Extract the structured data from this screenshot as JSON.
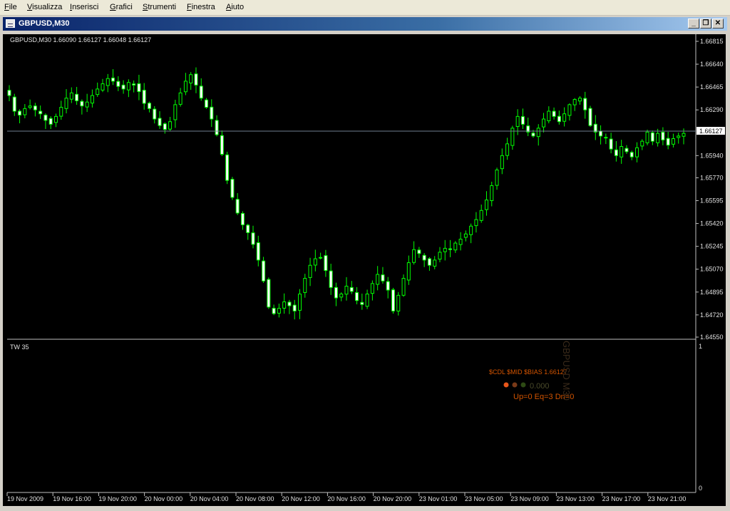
{
  "menu": [
    {
      "label": "File",
      "accel": "F",
      "rest": "ile"
    },
    {
      "label": "Visualizza",
      "accel": "V",
      "rest": "isualizza"
    },
    {
      "label": "Inserisci",
      "accel": "I",
      "rest": "nserisci"
    },
    {
      "label": "Grafici",
      "accel": "G",
      "rest": "rafici"
    },
    {
      "label": "Strumenti",
      "accel": "S",
      "rest": "trumenti"
    },
    {
      "label": "Finestra",
      "accel": "F",
      "rest": "inestra"
    },
    {
      "label": "Aiuto",
      "accel": "A",
      "rest": "iuto"
    }
  ],
  "window": {
    "title": "GBPUSD,M30",
    "buttons": {
      "minimize": "_",
      "restore": "❐",
      "close": "✕"
    }
  },
  "chart_data": {
    "type": "candlestick",
    "symbol_header": "GBPUSD,M30  1.66090 1.66127 1.66048 1.66127",
    "y_ticks": [
      "1.66815",
      "1.66640",
      "1.66465",
      "1.66290",
      "1.66127",
      "1.65940",
      "1.65770",
      "1.65595",
      "1.65420",
      "1.65245",
      "1.65070",
      "1.64895",
      "1.64720",
      "1.64550"
    ],
    "ylim": [
      1.6455,
      1.66815
    ],
    "current_price": "1.66127",
    "x_ticks": [
      "19 Nov 2009",
      "19 Nov 16:00",
      "19 Nov 20:00",
      "20 Nov 00:00",
      "20 Nov 04:00",
      "20 Nov 08:00",
      "20 Nov 12:00",
      "20 Nov 16:00",
      "20 Nov 20:00",
      "23 Nov 01:00",
      "23 Nov 05:00",
      "23 Nov 09:00",
      "23 Nov 13:00",
      "23 Nov 17:00",
      "23 Nov 21:00"
    ],
    "close_path": [
      1.664,
      1.6628,
      1.6625,
      1.663,
      1.6632,
      1.6629,
      1.6626,
      1.6621,
      1.6618,
      1.6624,
      1.6631,
      1.6638,
      1.6642,
      1.6636,
      1.6632,
      1.6635,
      1.664,
      1.6645,
      1.6649,
      1.6653,
      1.6651,
      1.6647,
      1.6645,
      1.665,
      1.6648,
      1.6643,
      1.6634,
      1.663,
      1.6622,
      1.6617,
      1.6614,
      1.662,
      1.6633,
      1.6642,
      1.6651,
      1.6656,
      1.6648,
      1.6638,
      1.6631,
      1.6622,
      1.661,
      1.6595,
      1.6575,
      1.6562,
      1.655,
      1.6541,
      1.6535,
      1.6526,
      1.6514,
      1.6498,
      1.6478,
      1.6473,
      1.6477,
      1.6482,
      1.6479,
      1.6475,
      1.6488,
      1.65,
      1.651,
      1.6515,
      1.6516,
      1.6506,
      1.6493,
      1.6485,
      1.6488,
      1.6494,
      1.649,
      1.6483,
      1.648,
      1.6488,
      1.6496,
      1.6503,
      1.6498,
      1.6491,
      1.6475,
      1.6487,
      1.65,
      1.6512,
      1.6522,
      1.6519,
      1.6514,
      1.651,
      1.6514,
      1.652,
      1.6523,
      1.6522,
      1.6527,
      1.653,
      1.6534,
      1.654,
      1.6545,
      1.6552,
      1.656,
      1.6571,
      1.6583,
      1.6594,
      1.6603,
      1.6615,
      1.6624,
      1.6618,
      1.6612,
      1.6609,
      1.6615,
      1.6622,
      1.6628,
      1.6624,
      1.662,
      1.6626,
      1.6633,
      1.6637,
      1.6638,
      1.6629,
      1.6617,
      1.6612,
      1.6609,
      1.6608,
      1.6599,
      1.6594,
      1.6601,
      1.6597,
      1.6593,
      1.66,
      1.6605,
      1.6612,
      1.6605,
      1.6611,
      1.6606,
      1.6602,
      1.6607,
      1.6609,
      1.6611
    ]
  },
  "indicator": {
    "name": "TW 35",
    "scale_top": "1",
    "scale_bottom": "0",
    "line1": "$CDL $MID $BIAS    1.66127",
    "dots_value": "0.000",
    "line3": "Up=0 Eq=3 Dn=0",
    "vertical_text": "GBPUSD M30",
    "colors": {
      "orange": "#d35400",
      "dot1": "#e8561a",
      "dot2": "#7a3a18",
      "dot3": "#2d4a14",
      "dim": "#4a4a2a"
    }
  }
}
